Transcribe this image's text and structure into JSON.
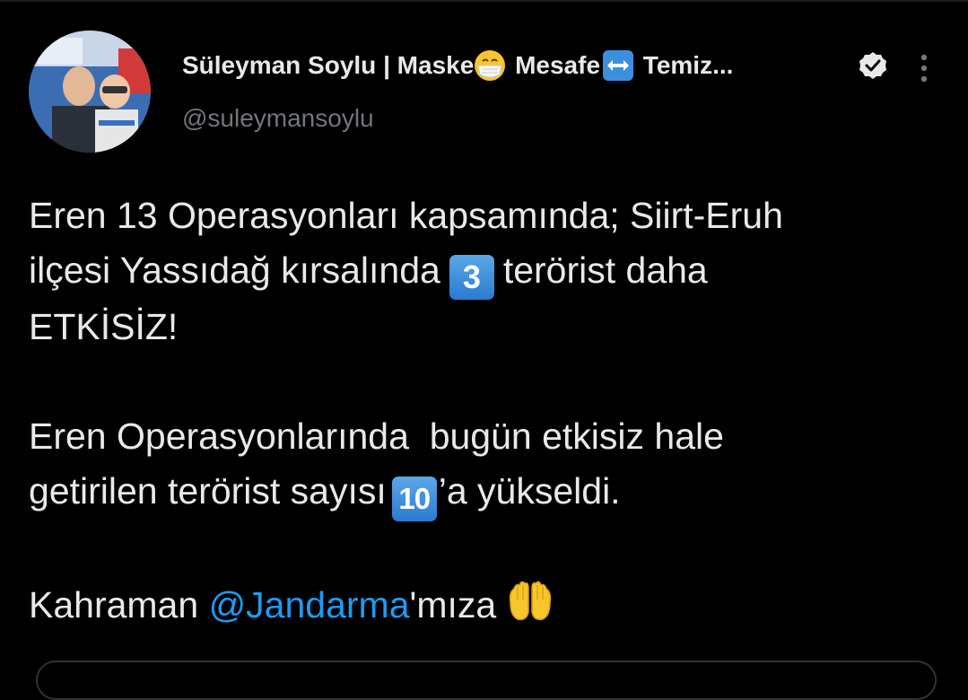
{
  "author": {
    "name_part1": "Süleyman Soylu | Maske",
    "name_part2": " Mesafe",
    "name_part3": " Temiz...",
    "handle": "@suleymansoylu",
    "verified": true,
    "emoji_1": "mask-face-emoji",
    "emoji_2": "left-right-arrow-emoji"
  },
  "tweet": {
    "p1_line1": "Eren 13 Operasyonları kapsamında; Siirt-Eruh",
    "p1_line2_a": "ilçesi Yassıdağ kırsalında",
    "keycap_1": "3",
    "p1_line2_b": "terörist daha",
    "p1_line3": "ETKİSİZ!",
    "p2_line1": "Eren Operasyonlarında  bugün etkisiz hale",
    "p2_line2_a": "getirilen terörist sayısı",
    "keycap_2": "10",
    "p2_line2_b": "’a yükseldi.",
    "p3_a": "Kahraman ",
    "p3_mention": "@Jandarma",
    "p3_b": "'mıza",
    "p3_emoji": "raised-hands-emoji"
  },
  "colors": {
    "background": "#000000",
    "text": "#e7e9ea",
    "secondary": "#71767b",
    "link": "#1d9bf0"
  }
}
